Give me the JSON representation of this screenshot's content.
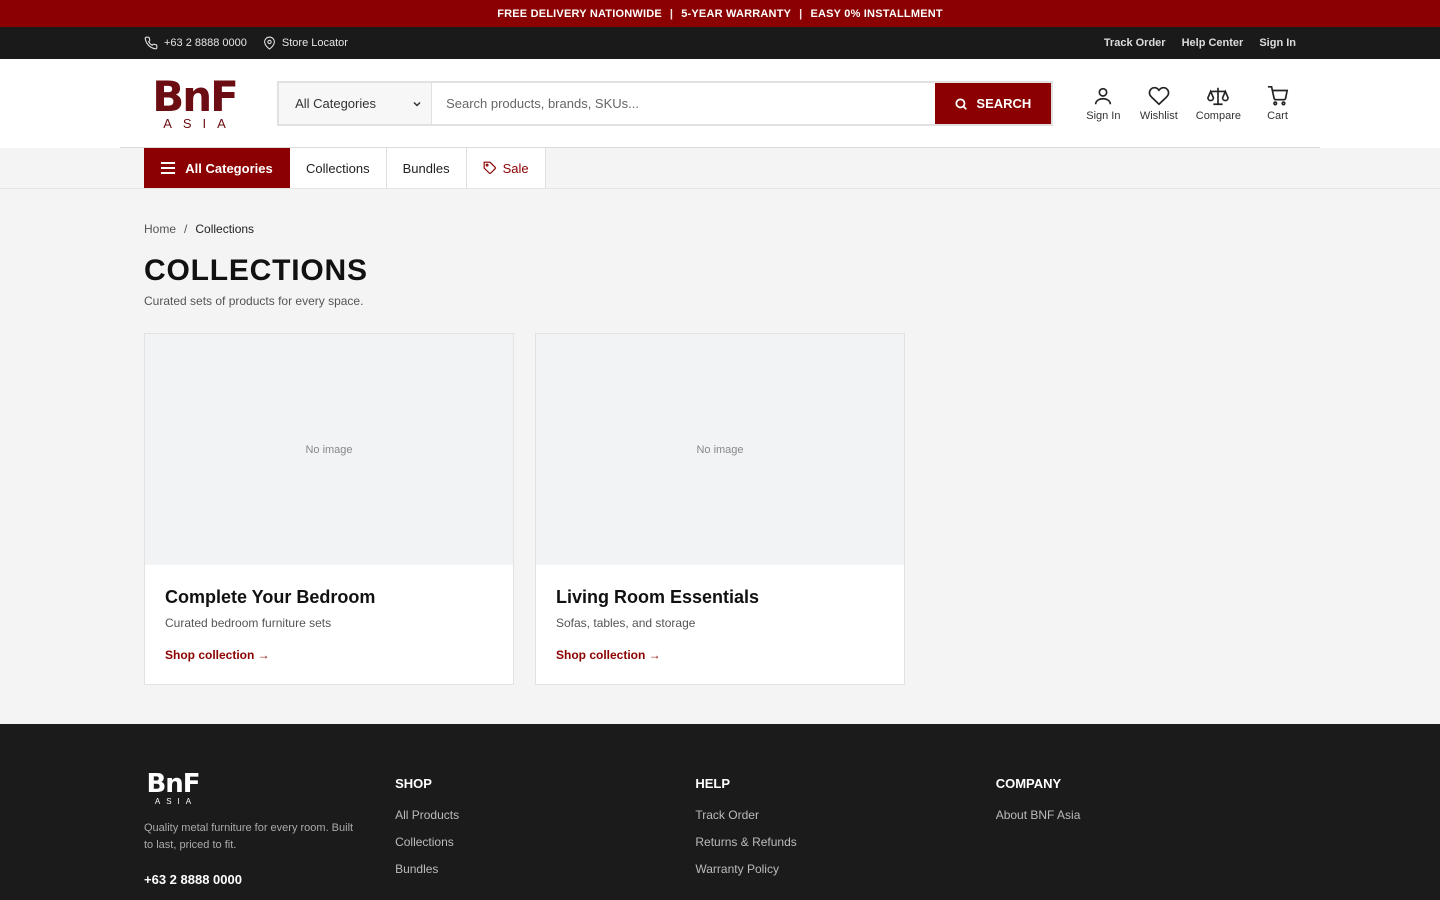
{
  "promo": {
    "item1": "FREE DELIVERY NATIONWIDE",
    "sep1": "|",
    "item2": "5-YEAR WARRANTY",
    "sep2": "|",
    "item3": "EASY 0% INSTALLMENT"
  },
  "utility": {
    "phone": "+63 2 8888 0000",
    "store_locator": "Store Locator",
    "track_order": "Track Order",
    "help_center": "Help Center",
    "sign_in": "Sign In"
  },
  "logo": {
    "mark": "BnF",
    "sub": "ASIA"
  },
  "search": {
    "category": "All Categories",
    "placeholder": "Search products, brands, SKUs...",
    "button": "SEARCH"
  },
  "actions": {
    "sign_in": "Sign In",
    "wishlist": "Wishlist",
    "compare": "Compare",
    "cart": "Cart"
  },
  "catnav": {
    "all_categories": "All Categories",
    "collections": "Collections",
    "bundles": "Bundles",
    "sale": "Sale"
  },
  "breadcrumb": {
    "home": "Home",
    "sep": "/",
    "current": "Collections"
  },
  "page": {
    "title": "COLLECTIONS",
    "subtitle": "Curated sets of products for every space."
  },
  "cards": [
    {
      "image_text": "No image",
      "title": "Complete Your Bedroom",
      "desc": "Curated bedroom furniture sets",
      "link": "Shop collection →"
    },
    {
      "image_text": "No image",
      "title": "Living Room Essentials",
      "desc": "Sofas, tables, and storage",
      "link": "Shop collection →"
    }
  ],
  "footer": {
    "logo_mark": "BnF",
    "logo_sub": "ASIA",
    "tagline": "Quality metal furniture for every room. Built to last, priced to fit.",
    "phone": "+63 2 8888 0000",
    "shop": {
      "title": "SHOP",
      "links": [
        "All Products",
        "Collections",
        "Bundles"
      ]
    },
    "help": {
      "title": "HELP",
      "links": [
        "Track Order",
        "Returns & Refunds",
        "Warranty Policy"
      ]
    },
    "company": {
      "title": "COMPANY",
      "links": [
        "About BNF Asia"
      ]
    }
  },
  "colors": {
    "brand": "#8b0000",
    "logo": "#6b0d12",
    "footer_bg": "#1b1b1b",
    "utility_bg": "#1a1a1a"
  }
}
